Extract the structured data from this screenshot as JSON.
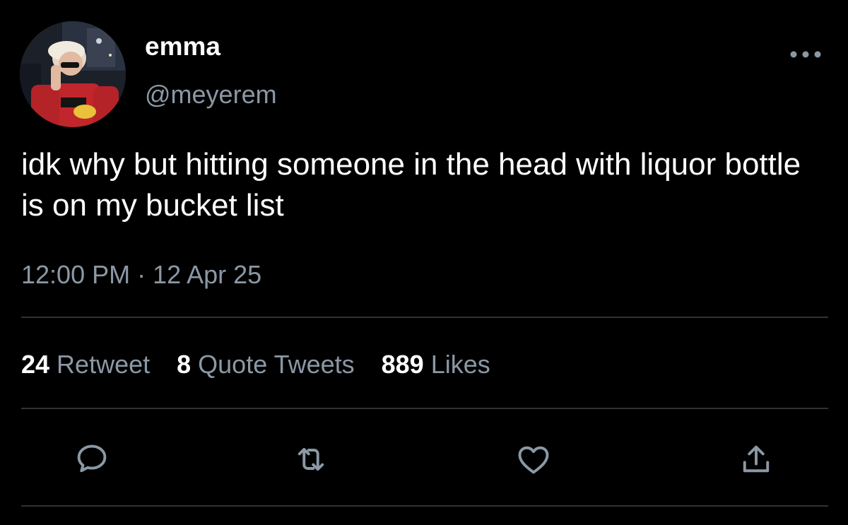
{
  "author": {
    "display_name": "emma",
    "handle": "@meyerem"
  },
  "tweet": {
    "text": "idk why but hitting someone in the head with liquor bottle is on my bucket list",
    "timestamp": "12:00 PM · 12 Apr 25"
  },
  "stats": {
    "retweets_count": "24",
    "retweets_label": "Retweet",
    "quotes_count": "8",
    "quotes_label": "Quote Tweets",
    "likes_count": "889",
    "likes_label": "Likes"
  },
  "actions": [
    {
      "icon": "reply-icon"
    },
    {
      "icon": "retweet-icon"
    },
    {
      "icon": "like-icon"
    },
    {
      "icon": "share-icon"
    }
  ],
  "colors": {
    "background": "#000000",
    "primary_text": "#ffffff",
    "secondary_text": "#8b98a5",
    "divider": "#2f3336"
  }
}
